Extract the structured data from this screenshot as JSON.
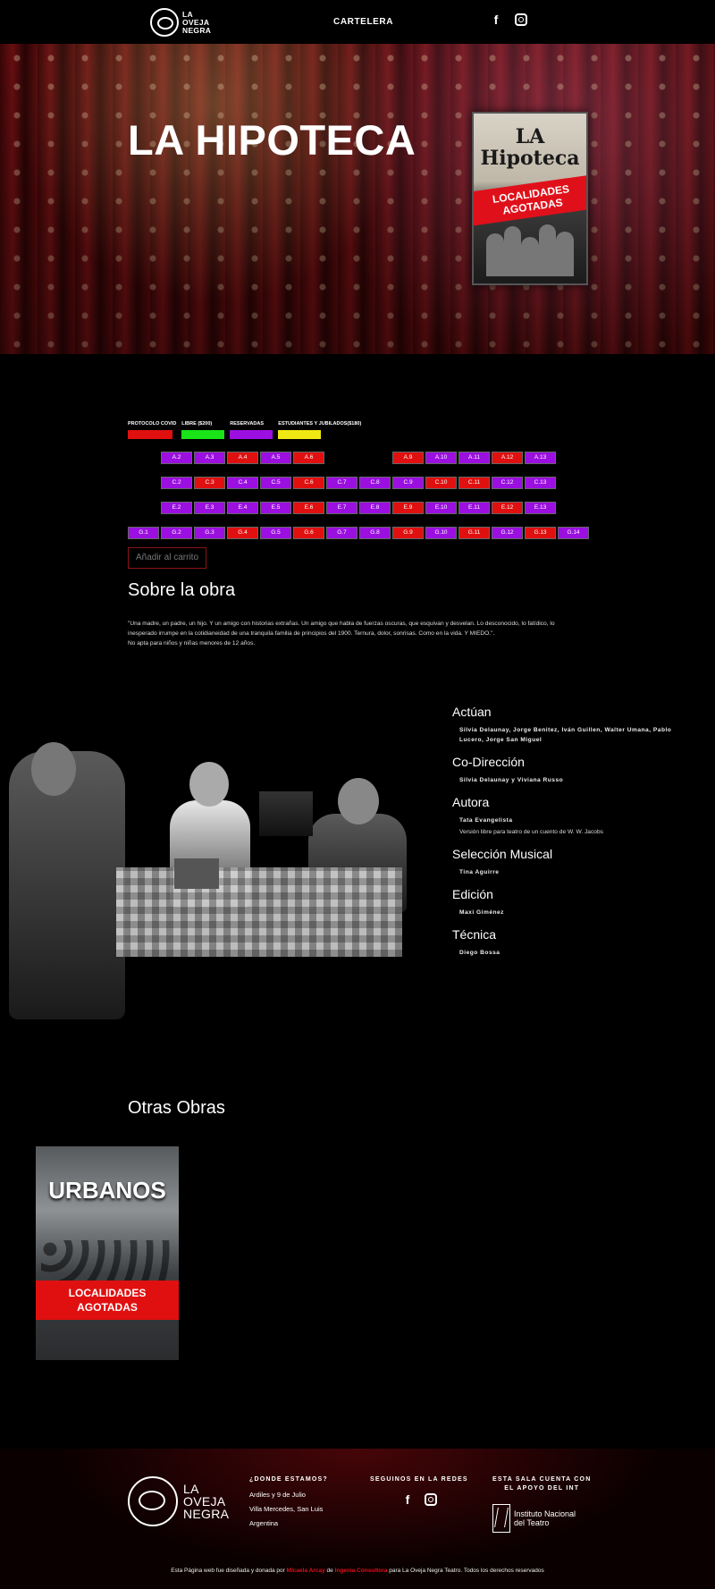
{
  "header": {
    "logo_line1": "LA",
    "logo_line2": "OVEJA",
    "logo_line3": "NEGRA",
    "nav_cartelera": "CARTELERA",
    "facebook_icon": "facebook-icon",
    "instagram_icon": "instagram-icon"
  },
  "hero": {
    "title": "LA HIPOTECA",
    "poster_title_line1": "LA",
    "poster_title_line2": "Hipoteca",
    "poster_band_line1": "LOCALIDADES",
    "poster_band_line2": "AGOTADAS"
  },
  "legend": [
    {
      "label": "PROTOCOLO COVID",
      "color": "#e01010"
    },
    {
      "label": "LIBRE ($200)",
      "color": "#18e418"
    },
    {
      "label": "RESERVADAS",
      "color": "#9b0fe0"
    },
    {
      "label": "ESTUDIANTES Y JUBILADOS($180)",
      "color": "#f0e812"
    }
  ],
  "colors": {
    "libre": "#9b0fe0",
    "reservada": "#e01010",
    "accent_red": "#e0101a"
  },
  "seat_rows": [
    {
      "row": "A",
      "seats": [
        {
          "label": "A.2",
          "status": "libre"
        },
        {
          "label": "A.3",
          "status": "libre"
        },
        {
          "label": "A.4",
          "status": "reservada"
        },
        {
          "label": "A.5",
          "status": "libre"
        },
        {
          "label": "A.6",
          "status": "reservada"
        },
        {
          "label": "A.9",
          "status": "reservada"
        },
        {
          "label": "A.10",
          "status": "libre"
        },
        {
          "label": "A.11",
          "status": "libre"
        },
        {
          "label": "A.12",
          "status": "reservada"
        },
        {
          "label": "A.13",
          "status": "libre"
        }
      ]
    },
    {
      "row": "C",
      "seats": [
        {
          "label": "C.2",
          "status": "libre"
        },
        {
          "label": "C.3",
          "status": "reservada"
        },
        {
          "label": "C.4",
          "status": "libre"
        },
        {
          "label": "C.5",
          "status": "libre"
        },
        {
          "label": "C.6",
          "status": "reservada"
        },
        {
          "label": "C.7",
          "status": "libre"
        },
        {
          "label": "C.8",
          "status": "libre"
        },
        {
          "label": "C.9",
          "status": "libre"
        },
        {
          "label": "C.10",
          "status": "reservada"
        },
        {
          "label": "C.11",
          "status": "reservada"
        },
        {
          "label": "C.12",
          "status": "libre"
        },
        {
          "label": "C.13",
          "status": "libre"
        }
      ]
    },
    {
      "row": "E",
      "seats": [
        {
          "label": "E.2",
          "status": "libre"
        },
        {
          "label": "E.3",
          "status": "libre"
        },
        {
          "label": "E.4",
          "status": "libre"
        },
        {
          "label": "E.5",
          "status": "libre"
        },
        {
          "label": "E.6",
          "status": "reservada"
        },
        {
          "label": "E.7",
          "status": "libre"
        },
        {
          "label": "E.8",
          "status": "libre"
        },
        {
          "label": "E.9",
          "status": "reservada"
        },
        {
          "label": "E.10",
          "status": "libre"
        },
        {
          "label": "E.11",
          "status": "libre"
        },
        {
          "label": "E.12",
          "status": "reservada"
        },
        {
          "label": "E.13",
          "status": "libre"
        }
      ]
    },
    {
      "row": "G",
      "seats": [
        {
          "label": "G.1",
          "status": "libre"
        },
        {
          "label": "G.2",
          "status": "libre"
        },
        {
          "label": "G.3",
          "status": "libre"
        },
        {
          "label": "G.4",
          "status": "reservada"
        },
        {
          "label": "G.5",
          "status": "libre"
        },
        {
          "label": "G.6",
          "status": "reservada"
        },
        {
          "label": "G.7",
          "status": "libre"
        },
        {
          "label": "G.8",
          "status": "libre"
        },
        {
          "label": "G.9",
          "status": "reservada"
        },
        {
          "label": "G.10",
          "status": "libre"
        },
        {
          "label": "G.11",
          "status": "reservada"
        },
        {
          "label": "G.12",
          "status": "libre"
        },
        {
          "label": "G.13",
          "status": "reservada"
        },
        {
          "label": "G.14",
          "status": "libre"
        }
      ]
    }
  ],
  "cart": {
    "add_label": "Añadir al carrito"
  },
  "sobre": {
    "heading": "Sobre la obra",
    "synopsis_line1": "\"Una madre, un padre, un hijo. Y un amigo con historias extrañas. Un amigo que habla de fuerzas oscuras, que esquivan y desvelan. Lo desconocido, lo fatídico, lo",
    "synopsis_line2": "inesperado irrumpe en la cotidianeidad de una tranquila familia de principios del 1900. Ternura, dolor, sonrisas. Como en la vida. Y MIEDO.\".",
    "synopsis_line3": "No apta para niños y niñas menores de 12 años."
  },
  "credits": [
    {
      "heading": "Actúan",
      "value": "Silvia Delaunay, Jorge Benitez, Iván Guillen, Walter Umana, Pablo Lucero, Jorge San Miguel",
      "note": ""
    },
    {
      "heading": "Co-Dirección",
      "value": "Silvia Delaunay y Viviana Russo",
      "note": ""
    },
    {
      "heading": "Autora",
      "value": "Tata Evangelista",
      "note": "Versión libre para teatro de un cuento de W. W. Jacobs"
    },
    {
      "heading": "Selección Musical",
      "value": "Tina Aguirre",
      "note": ""
    },
    {
      "heading": "Edición",
      "value": "Maxi Giménez",
      "note": ""
    },
    {
      "heading": "Técnica",
      "value": "Diego Bossa",
      "note": ""
    }
  ],
  "otras": {
    "heading": "Otras Obras",
    "card_title": "URBANOS",
    "card_band_line1": "LOCALIDADES",
    "card_band_line2": "AGOTADAS"
  },
  "footer": {
    "logo_line1": "LA",
    "logo_line2": "OVEJA",
    "logo_line3": "NEGRA",
    "donde_heading": "¿DONDE ESTAMOS?",
    "address1": "Ardiles y 9 de Julio",
    "address2": "Villa Mercedes, San Luis",
    "address3": "Argentina",
    "redes_heading": "SEGUINOS EN LA REDES",
    "apoyo_heading_line1": "ESTA SALA CUENTA CON",
    "apoyo_heading_line2": "EL APOYO DEL INT",
    "int_line1": "Instituto Nacional",
    "int_line2": "del Teatro",
    "copy_before": "Esta Página web fue diseñada y donada por ",
    "copy_name1": "Micaela Arcay",
    "copy_mid1": " de ",
    "copy_name2": "Ingenia Consultora",
    "copy_after": " para La Oveja Negra Teatro. Todos los derechos reservados"
  }
}
